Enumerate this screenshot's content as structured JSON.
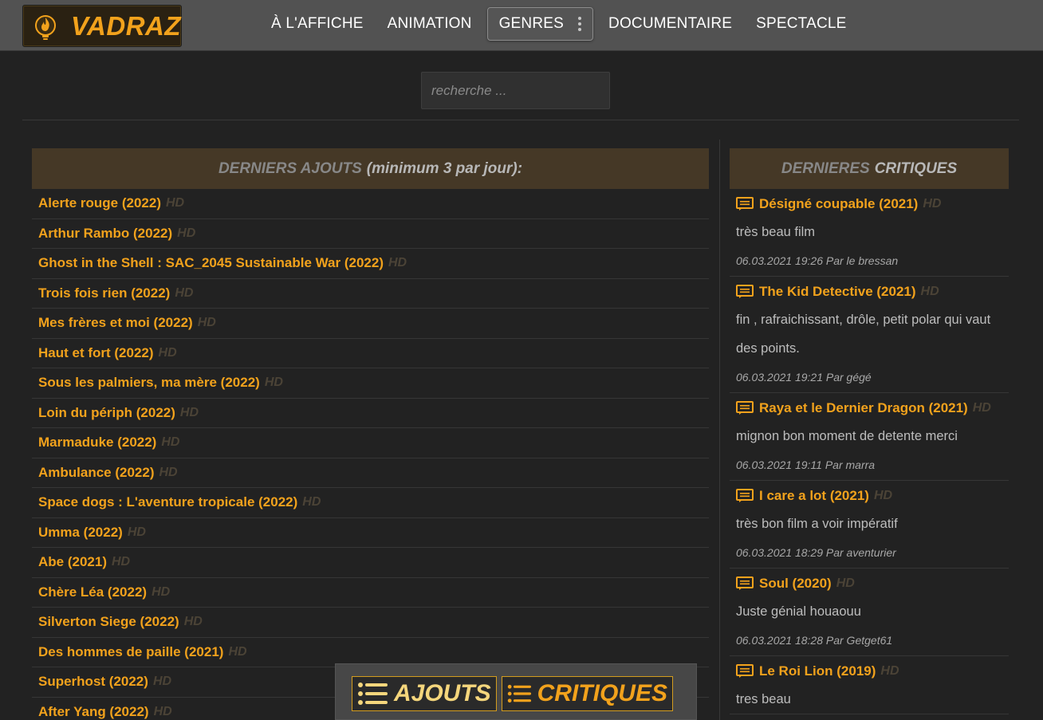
{
  "brand": {
    "name": "VADRAZ",
    "accent": "#f2a21c",
    "logo_icon": "flame-bulb-icon"
  },
  "nav": [
    {
      "label": "À L'AFFICHE"
    },
    {
      "label": "ANIMATION"
    },
    {
      "label": "GENRES"
    },
    {
      "label": "DOCUMENTAIRE"
    },
    {
      "label": "SPECTACLE"
    }
  ],
  "search": {
    "placeholder": "recherche ..."
  },
  "latest": {
    "heading_main": "DERNIERS AJOUTS",
    "heading_sub": "(minimum 3 par jour):",
    "items": [
      {
        "title": "Alerte rouge (2022)",
        "badge": "HD"
      },
      {
        "title": "Arthur Rambo (2022)",
        "badge": "HD"
      },
      {
        "title": "Ghost in the Shell : SAC_2045 Sustainable War (2022)",
        "badge": "HD"
      },
      {
        "title": "Trois fois rien (2022)",
        "badge": "HD"
      },
      {
        "title": "Mes frères et moi (2022)",
        "badge": "HD"
      },
      {
        "title": "Haut et fort (2022)",
        "badge": "HD"
      },
      {
        "title": "Sous les palmiers, ma mère (2022)",
        "badge": "HD"
      },
      {
        "title": "Loin du périph (2022)",
        "badge": "HD"
      },
      {
        "title": "Marmaduke (2022)",
        "badge": "HD"
      },
      {
        "title": "Ambulance (2022)",
        "badge": "HD"
      },
      {
        "title": "Space dogs : L'aventure tropicale (2022)",
        "badge": "HD"
      },
      {
        "title": "Umma (2022)",
        "badge": "HD"
      },
      {
        "title": "Abe (2021)",
        "badge": "HD"
      },
      {
        "title": "Chère Léa (2022)",
        "badge": "HD"
      },
      {
        "title": "Silverton Siege (2022)",
        "badge": "HD"
      },
      {
        "title": "Des hommes de paille (2021)",
        "badge": "HD"
      },
      {
        "title": "Superhost (2022)",
        "badge": "HD"
      },
      {
        "title": "After Yang (2022)",
        "badge": "HD"
      }
    ]
  },
  "reviews": {
    "heading_main": "DERNIERES",
    "heading_sub": "CRITIQUES",
    "icon": "comment-icon",
    "items": [
      {
        "title": "Désigné coupable (2021)",
        "badge": "HD",
        "text": "très beau film",
        "meta": "06.03.2021 19:26 Par le bressan"
      },
      {
        "title": "The Kid Detective (2021)",
        "badge": "HD",
        "text": "fin , rafraichissant, drôle, petit polar qui vaut des points.",
        "meta": "06.03.2021 19:21 Par gégé"
      },
      {
        "title": "Raya et le Dernier Dragon (2021)",
        "badge": "HD",
        "text": "mignon bon moment de detente merci",
        "meta": "06.03.2021 19:11 Par marra"
      },
      {
        "title": "I care a lot (2021)",
        "badge": "HD",
        "text": "très bon film a voir impératif",
        "meta": "06.03.2021 18:29 Par aventurier"
      },
      {
        "title": "Soul (2020)",
        "badge": "HD",
        "text": "Juste génial houaouu",
        "meta": "06.03.2021 18:28 Par Getget61"
      },
      {
        "title": "Le Roi Lion (2019)",
        "badge": "HD",
        "text": "tres beau",
        "meta": ""
      }
    ]
  },
  "floatbar": {
    "ajouts_label": "AJOUTS",
    "critiques_label": "CRITIQUES",
    "icon": "list-icon"
  }
}
